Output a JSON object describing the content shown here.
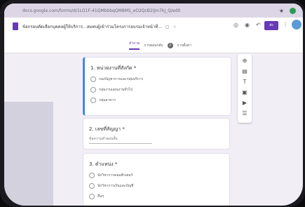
{
  "browser": {
    "url": "docs.google.com/forms/d/1LG1F-41QMbbbqQM8MS_eO2QcB2lJm7kJ_Q/edit"
  },
  "header": {
    "form_title": "ข้อกรอบคัดเลือกบุคคลผู้ให้บริการ...สมทบผู้เข้าร่วมโครงการอบรมเจ้าหน้าที่...",
    "send_label": "ส่ง",
    "tabs": [
      {
        "label": "คำถาม"
      },
      {
        "label": "การตอบกลับ"
      },
      {
        "label": "การตั้งค่า"
      }
    ],
    "responses_count": "2"
  },
  "questions": [
    {
      "title": "1. หน่วยงานที่สังกัด *",
      "options": [
        "กองบัญชาการและกลุ่มบริการ",
        "กลุ่มงานแผนงานทั่วไป",
        "กลุ่มอาคาร"
      ]
    },
    {
      "title": "2. เลขที่สัญญา *",
      "answer_placeholder": "ข้อความคำตอบสั้น"
    },
    {
      "title": "3. ตำแหน่ง *",
      "options": [
        "นักวิชาการคอมพิวเตอร์",
        "นักวิชาการเงินและบัญชี",
        "อื่นๆ"
      ]
    }
  ],
  "colors": {
    "accent": "#673ab7",
    "focus": "#4285f4",
    "page_bg": "#f1eef6"
  }
}
